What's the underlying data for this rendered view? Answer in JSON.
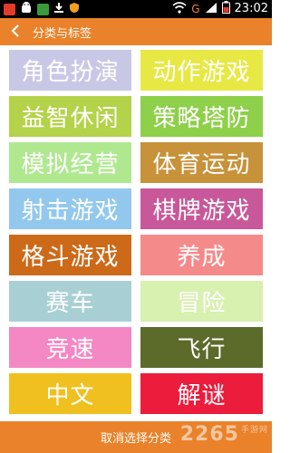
{
  "status_bar": {
    "time": "23:02",
    "left_icons": [
      "app-icon",
      "android-icon",
      "game-icon",
      "download-icon",
      "shield-icon"
    ],
    "right_icons": [
      "wifi-icon",
      "signal-icon",
      "battery-icon"
    ],
    "network_label": "G"
  },
  "header": {
    "title": "分类与标签",
    "background": "#e9822a"
  },
  "categories": [
    {
      "label": "角色扮演",
      "color": "#c8c8e6"
    },
    {
      "label": "动作游戏",
      "color": "#e8e845"
    },
    {
      "label": "益智休闲",
      "color": "#b4d24a"
    },
    {
      "label": "策略塔防",
      "color": "#8ed04a"
    },
    {
      "label": "模拟经营",
      "color": "#b0e890"
    },
    {
      "label": "体育运动",
      "color": "#c8923a"
    },
    {
      "label": "射击游戏",
      "color": "#92c8ee"
    },
    {
      "label": "棋牌游戏",
      "color": "#c8589a"
    },
    {
      "label": "格斗游戏",
      "color": "#cc6a1a"
    },
    {
      "label": "养成",
      "color": "#f58a8a"
    },
    {
      "label": "赛车",
      "color": "#a8d0d4"
    },
    {
      "label": "冒险",
      "color": "#d8f0b0"
    },
    {
      "label": "竞速",
      "color": "#f488c4"
    },
    {
      "label": "飞行",
      "color": "#5c6a2a"
    },
    {
      "label": "中文",
      "color": "#f0c020"
    },
    {
      "label": "解谜",
      "color": "#ec1c3c"
    }
  ],
  "bottom_bar": {
    "label": "取消选择分类"
  },
  "watermark": {
    "text": "2265",
    "sub": "手游网"
  }
}
